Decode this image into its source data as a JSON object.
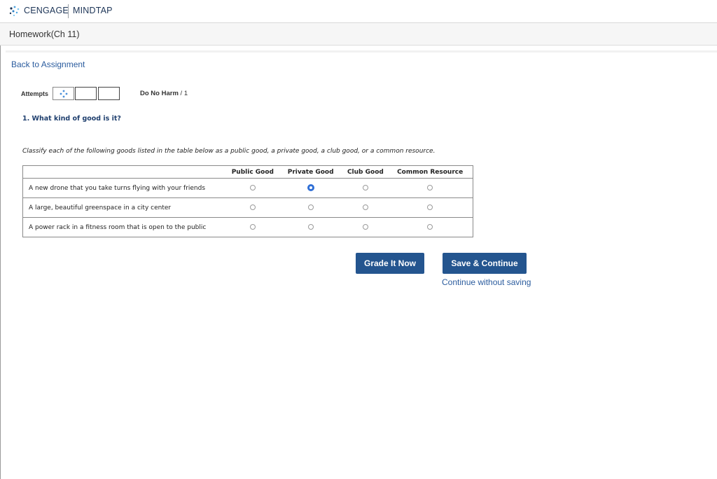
{
  "header": {
    "brand": "CENGAGE",
    "product": "MINDTAP",
    "logo_icon": "cengage-logo-icon"
  },
  "page": {
    "title": "Homework(Ch 11)",
    "back_link": "Back to Assignment"
  },
  "attempts": {
    "label": "Attempts",
    "boxes": 3,
    "grade_name": "Do No Harm",
    "grade_suffix": " / 1"
  },
  "question": {
    "heading": "1. What kind of good is it?",
    "instructions": "Classify each of the following goods listed in the table below as a public good, a private good, a club good, or a common resource."
  },
  "table": {
    "columns": [
      "Public Good",
      "Private Good",
      "Club Good",
      "Common Resource"
    ],
    "rows": [
      {
        "item": "A new drone that you take turns flying with your friends",
        "selected": 1
      },
      {
        "item": "A large, beautiful greenspace in a city center",
        "selected": -1
      },
      {
        "item": "A power rack in a fitness room that is open to the public",
        "selected": -1
      }
    ]
  },
  "actions": {
    "grade": "Grade It Now",
    "save": "Save & Continue",
    "continue": "Continue without saving"
  },
  "colors": {
    "accent": "#24558f",
    "link": "#2b5c9e",
    "selected_radio": "#2f6fd6"
  }
}
